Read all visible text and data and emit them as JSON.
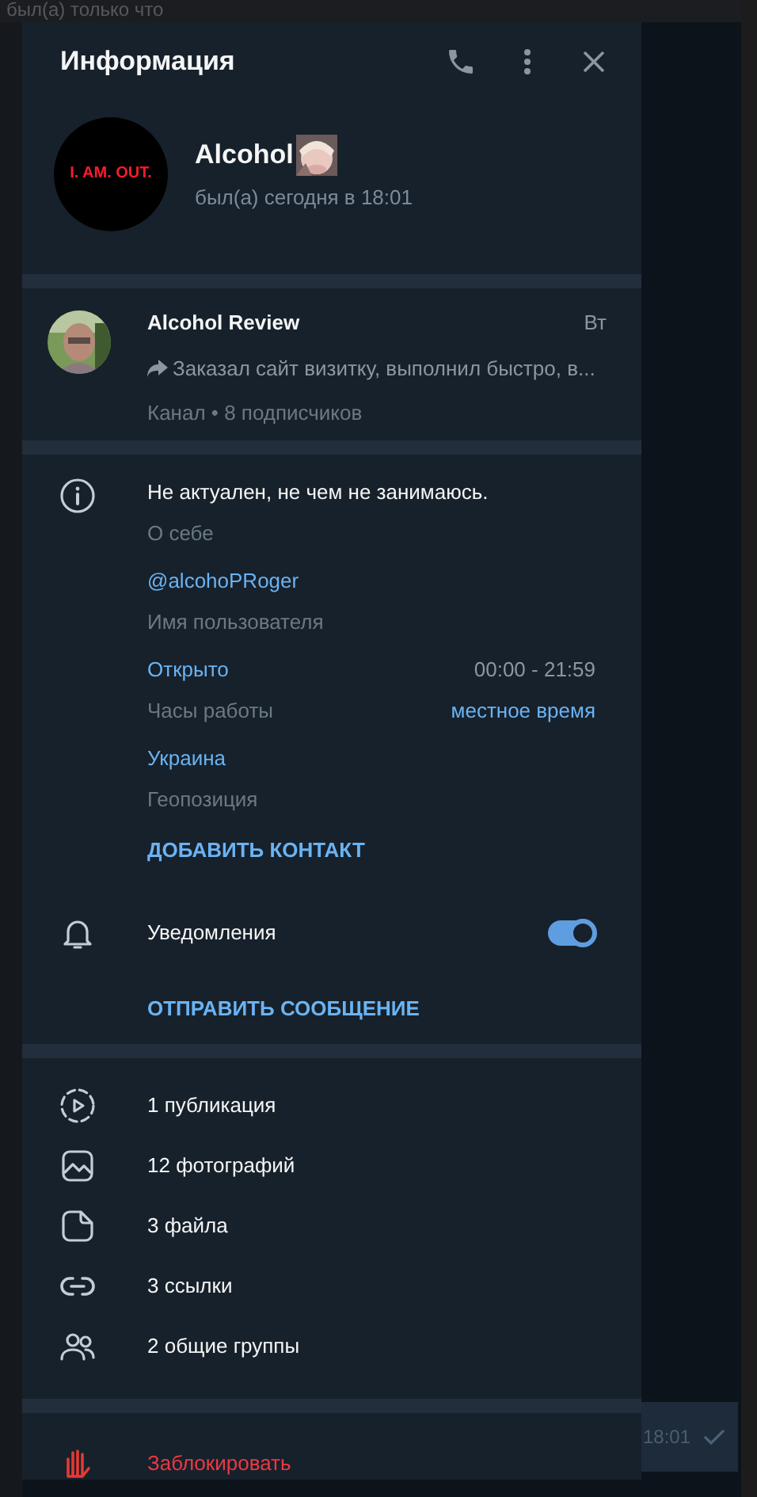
{
  "background": {
    "status": "был(а) только что",
    "time": "18:01"
  },
  "panel": {
    "title": "Информация"
  },
  "profile": {
    "name": "Alcohol",
    "status": "был(а) сегодня в 18:01",
    "avatar_text": "I. AM. OUT."
  },
  "channel": {
    "name": "Alcohol Review",
    "time": "Вт",
    "preview": "Заказал сайт визитку, выполнил быстро, в...",
    "meta": "Канал • 8 подписчиков"
  },
  "info": [
    {
      "kind": "about",
      "value": "Не актуален, не чем не занимаюсь.",
      "label": "О себе"
    },
    {
      "kind": "link",
      "value": "@alcohoPRoger",
      "label": "Имя пользователя"
    },
    {
      "kind": "hours",
      "value": "Открыто",
      "label": "Часы работы",
      "hours": "00:00 - 21:59",
      "zone": "местное время"
    },
    {
      "kind": "link",
      "value": "Украина",
      "label": "Геопозиция"
    }
  ],
  "add_contact": "ДОБАВИТЬ КОНТАКТ",
  "notifications": {
    "label": "Уведомления",
    "on": true
  },
  "send_message": "ОТПРАВИТЬ СООБЩЕНИЕ",
  "media": [
    {
      "kind": "stories",
      "label": "1 публикация"
    },
    {
      "kind": "photos",
      "label": "12 фотографий"
    },
    {
      "kind": "files",
      "label": "3 файла"
    },
    {
      "kind": "links",
      "label": "3 ссылки"
    },
    {
      "kind": "groups",
      "label": "2 общие группы"
    }
  ],
  "block": "Заблокировать"
}
